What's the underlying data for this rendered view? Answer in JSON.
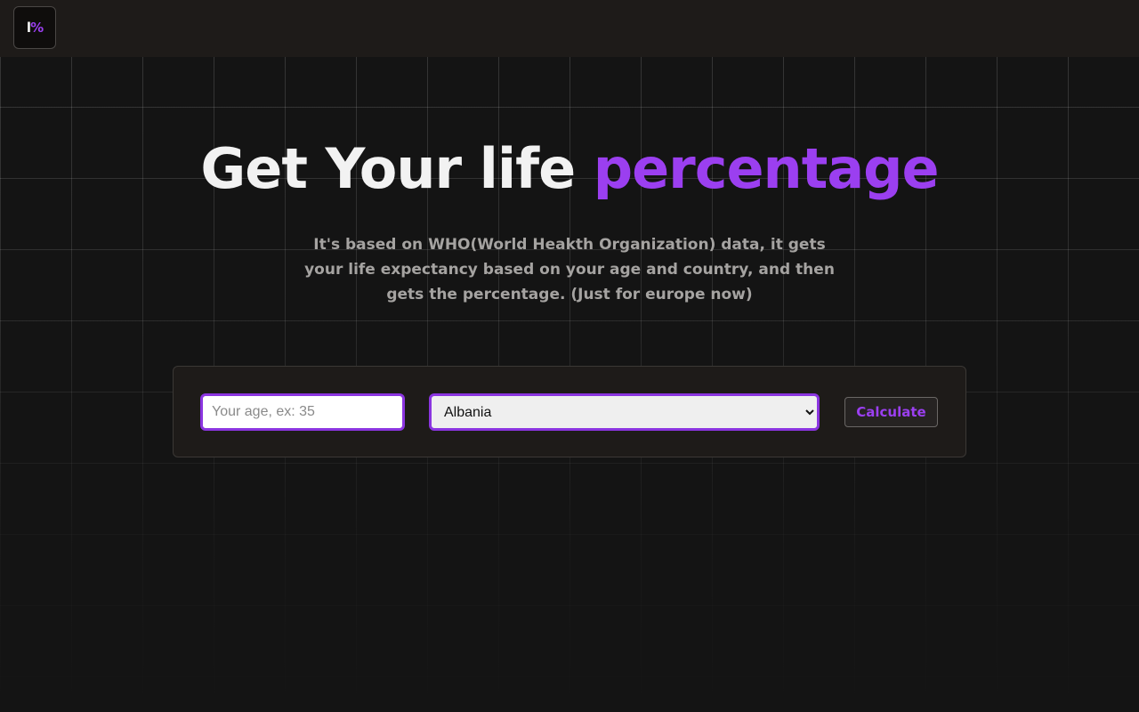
{
  "header": {
    "logo": {
      "letter": "l",
      "symbol": "%"
    }
  },
  "hero": {
    "title_main": "Get Your life ",
    "title_accent": "percentage",
    "subtitle": "It's based on WHO(World Heakth Organization) data, it gets your life expectancy based on your age and country, and then gets the percentage. (Just for europe now)"
  },
  "form": {
    "age_placeholder": "Your age, ex: 35",
    "age_value": "",
    "country_selected": "Albania",
    "calculate_label": "Calculate"
  },
  "colors": {
    "accent": "#9b3ff0",
    "background": "#141414",
    "topbar": "#1e1b19",
    "text_primary": "#f2f2f2",
    "text_muted": "#a5a3a1"
  }
}
